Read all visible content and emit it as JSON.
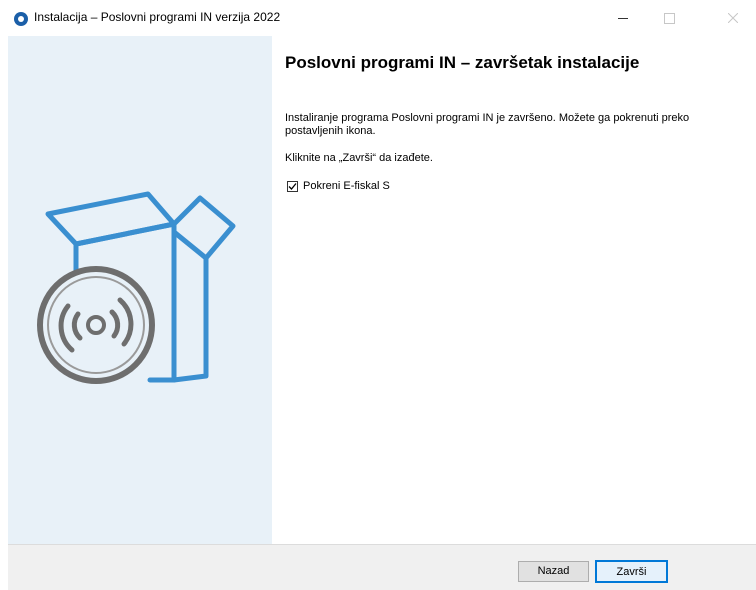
{
  "window": {
    "title": "Instalacija – Poslovni programi IN verzija 2022"
  },
  "content": {
    "heading": "Poslovni programi IN – završetak instalacije",
    "paragraph": "Instaliranje programa Poslovni programi IN je završeno. Možete ga pokrenuti preko postavljenih ikona.",
    "instruction": "Kliknite na „Završi“ da izađete.",
    "launch_checkbox": {
      "label": "Pokreni E-fiskal S",
      "checked": true
    }
  },
  "footer": {
    "back_label": "Nazad",
    "finish_label": "Završi"
  },
  "colors": {
    "side_panel_bg": "#e8f1f8",
    "box_blue": "#3a8fd0",
    "disc_gray": "#6e6e6e",
    "focus_border": "#0078d7"
  },
  "icons": {
    "app": "app-logo-icon",
    "minimize": "minimize-icon",
    "maximize": "maximize-icon",
    "close": "close-icon",
    "illustration": "box-with-disc-icon",
    "check": "checkmark-icon"
  }
}
